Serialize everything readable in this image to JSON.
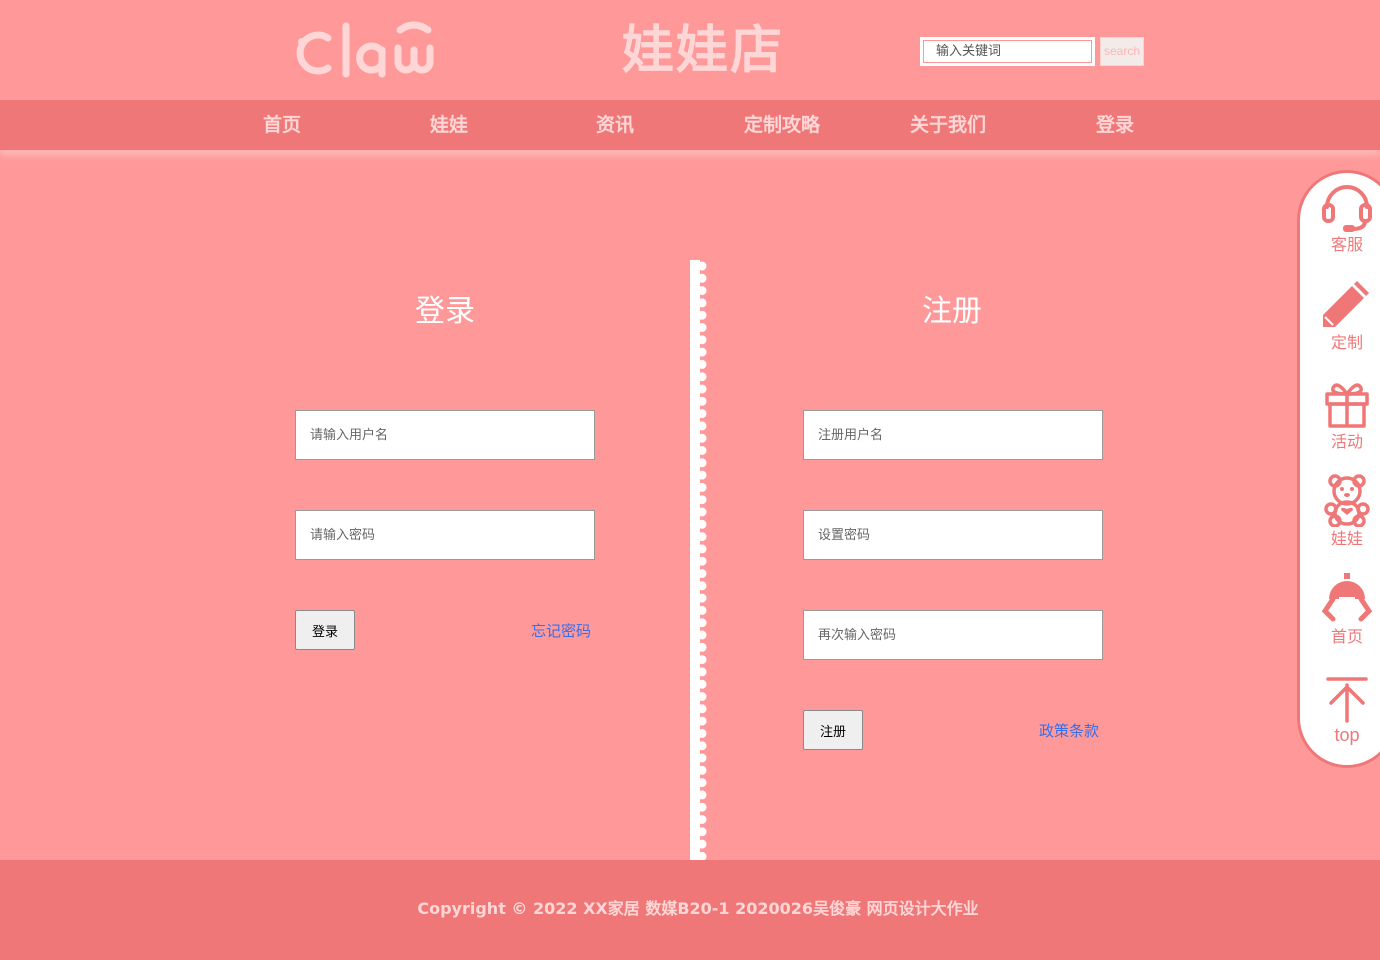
{
  "header": {
    "logo_text": "Claw",
    "site_title": "娃娃店",
    "search": {
      "placeholder": "输入关键词",
      "button_label": "search"
    }
  },
  "nav": {
    "items": [
      "首页",
      "娃娃",
      "资讯",
      "定制攻略",
      "关于我们",
      "登录"
    ]
  },
  "login": {
    "title": "登录",
    "username_placeholder": "请输入用户名",
    "password_placeholder": "请输入密码",
    "submit_label": "登录",
    "forgot_label": "忘记密码"
  },
  "register": {
    "title": "注册",
    "username_placeholder": "注册用户名",
    "password_placeholder": "设置密码",
    "confirm_placeholder": "再次输入密码",
    "submit_label": "注册",
    "policy_label": "政策条款"
  },
  "sidebar": {
    "items": [
      {
        "label": "客服",
        "icon": "headset-icon"
      },
      {
        "label": "定制",
        "icon": "pencil-icon"
      },
      {
        "label": "活动",
        "icon": "gift-icon"
      },
      {
        "label": "娃娃",
        "icon": "teddy-bear-icon"
      },
      {
        "label": "首页",
        "icon": "claw-icon"
      },
      {
        "label": "top",
        "icon": "arrow-up-icon"
      }
    ]
  },
  "footer": {
    "copyright": "Copyright © 2022 XX家居 数媒B20-1 2020026吴俊豪 网页设计大作业"
  },
  "colors": {
    "background": "#ff9999",
    "nav": "#f07777",
    "accent_light": "#ffd6d6",
    "link": "#3b6de6"
  }
}
